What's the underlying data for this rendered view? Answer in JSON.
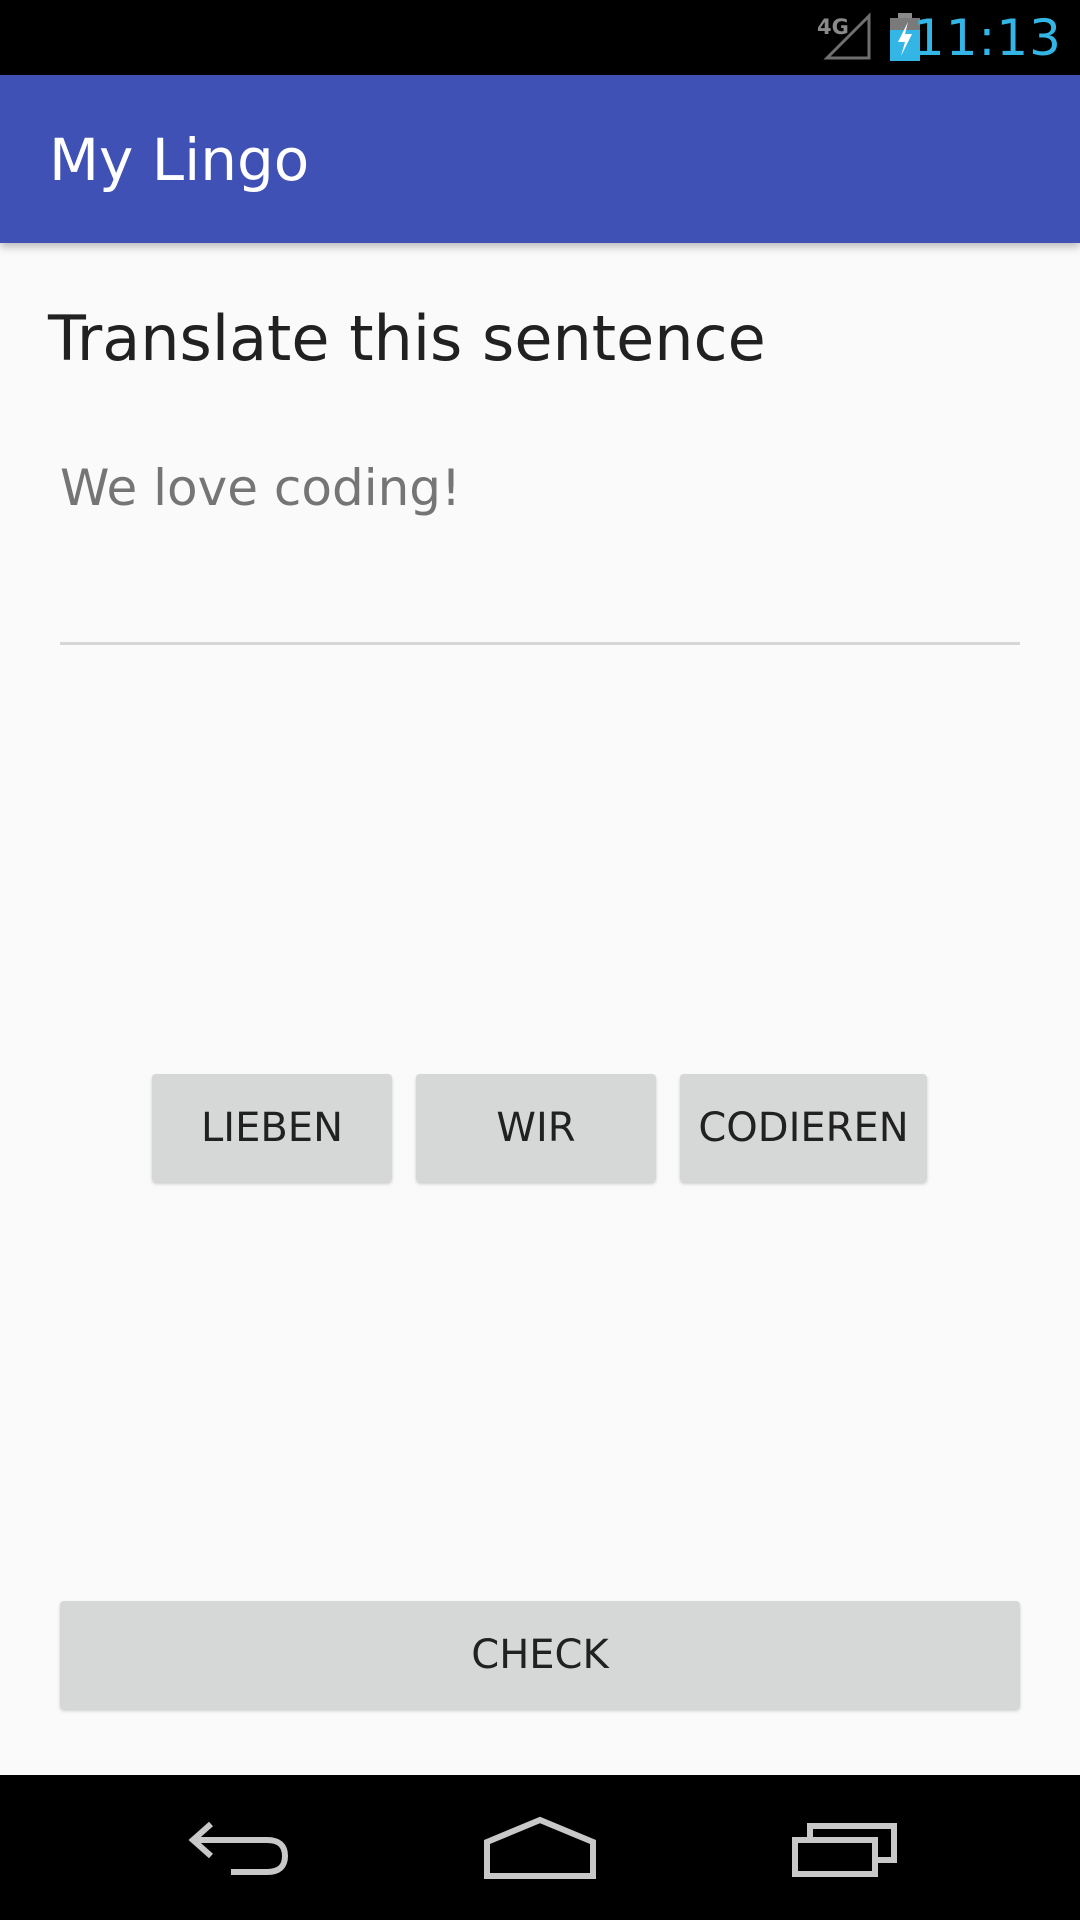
{
  "status_bar": {
    "network": "4G",
    "time": "11:13",
    "signal_icon": "signal-4g-icon",
    "battery_icon": "battery-charging-icon",
    "time_color": "#33b5e5"
  },
  "app_bar": {
    "title": "My Lingo",
    "color": "#3f51b5"
  },
  "exercise": {
    "heading": "Translate this sentence",
    "sentence": "We love coding!",
    "answer_value": "",
    "answer_placeholder": ""
  },
  "word_buttons": [
    {
      "label": "LIEBEN"
    },
    {
      "label": "WIR"
    },
    {
      "label": "CODIEREN"
    }
  ],
  "check_button": {
    "label": "CHECK"
  },
  "nav_bar": {
    "back_icon": "back-icon",
    "home_icon": "home-icon",
    "recents_icon": "recents-icon"
  }
}
